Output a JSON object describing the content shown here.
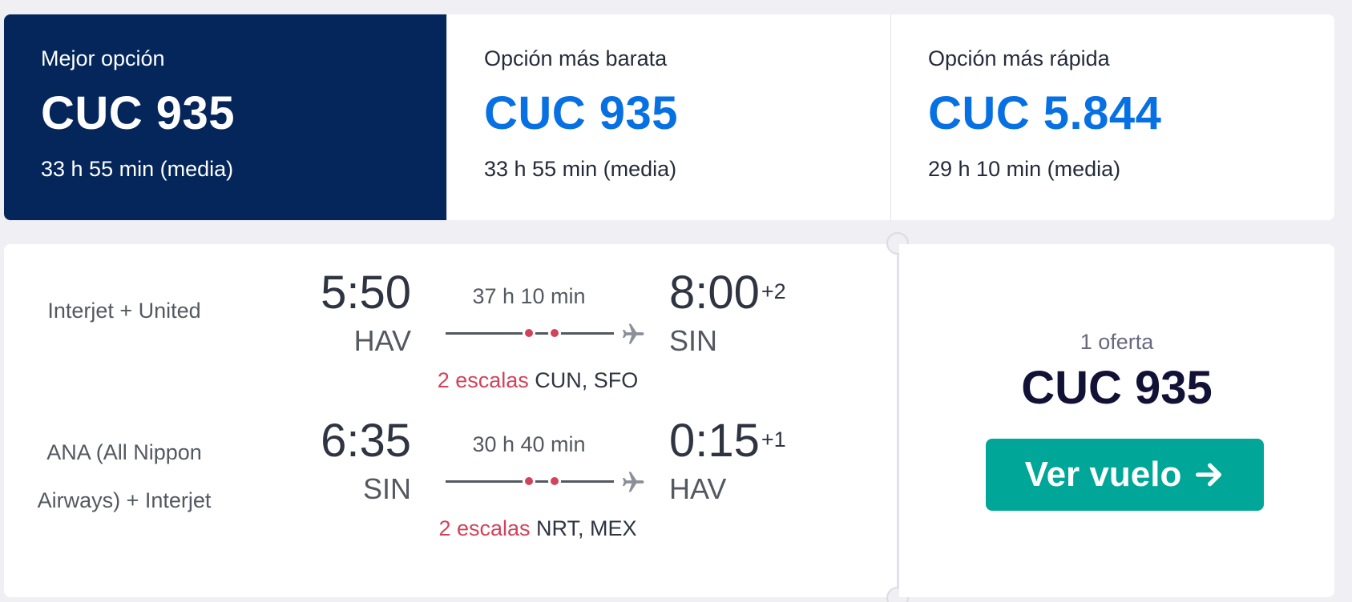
{
  "sort_tabs": [
    {
      "label": "Mejor opción",
      "price": "CUC 935",
      "duration": "33 h 55 min (media)",
      "active": true
    },
    {
      "label": "Opción más barata",
      "price": "CUC 935",
      "duration": "33 h 55 min (media)",
      "active": false
    },
    {
      "label": "Opción más rápida",
      "price": "CUC 5.844",
      "duration": "29 h 10 min (media)",
      "active": false
    }
  ],
  "result": {
    "legs": [
      {
        "carrier": "Interjet + United",
        "departure_time": "5:50",
        "departure_airport": "HAV",
        "duration": "37 h 10 min",
        "stops_count": "2 escalas",
        "stops_airports": "CUN, SFO",
        "arrival_time": "8:00",
        "arrival_day_offset": "+2",
        "arrival_airport": "SIN"
      },
      {
        "carrier": "ANA (All Nippon Airways) + Interjet",
        "departure_time": "6:35",
        "departure_airport": "SIN",
        "duration": "30 h 40 min",
        "stops_count": "2 escalas",
        "stops_airports": "NRT, MEX",
        "arrival_time": "0:15",
        "arrival_day_offset": "+1",
        "arrival_airport": "HAV"
      }
    ],
    "offers_count": "1 oferta",
    "price": "CUC 935",
    "select_label": "Ver vuelo"
  },
  "icons": {
    "plane": "plane-icon",
    "arrow": "arrow-right-icon"
  },
  "colors": {
    "active_tab_bg": "#05265a",
    "price_blue": "#0770e3",
    "stops_red": "#d1435b",
    "button_teal": "#00a698",
    "page_bg": "#efeff4"
  }
}
